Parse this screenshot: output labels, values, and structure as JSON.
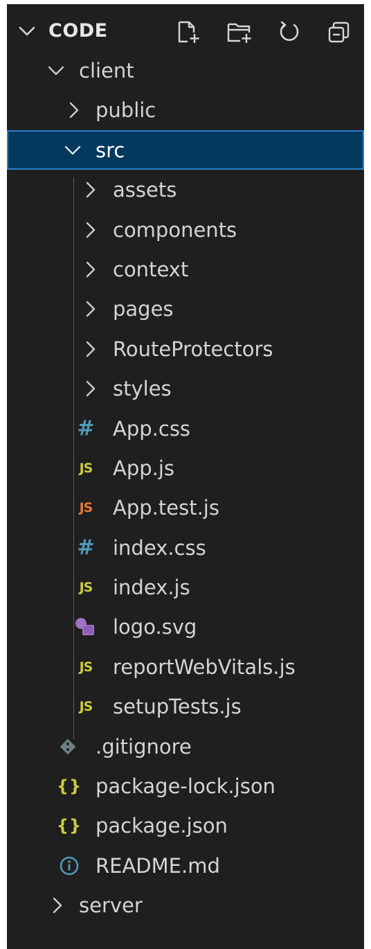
{
  "header": {
    "title": "CODE",
    "actions": [
      {
        "name": "new-file",
        "icon": "new-file-icon"
      },
      {
        "name": "new-folder",
        "icon": "new-folder-icon"
      },
      {
        "name": "refresh",
        "icon": "refresh-icon"
      },
      {
        "name": "collapse-all",
        "icon": "collapse-all-icon"
      }
    ]
  },
  "tree": [
    {
      "label": "client",
      "kind": "folder",
      "expanded": true,
      "depth": 0
    },
    {
      "label": "public",
      "kind": "folder",
      "expanded": false,
      "depth": 1
    },
    {
      "label": "src",
      "kind": "folder",
      "expanded": true,
      "depth": 1,
      "selected": true
    },
    {
      "label": "assets",
      "kind": "folder",
      "expanded": false,
      "depth": 2
    },
    {
      "label": "components",
      "kind": "folder",
      "expanded": false,
      "depth": 2
    },
    {
      "label": "context",
      "kind": "folder",
      "expanded": false,
      "depth": 2
    },
    {
      "label": "pages",
      "kind": "folder",
      "expanded": false,
      "depth": 2
    },
    {
      "label": "RouteProtectors",
      "kind": "folder",
      "expanded": false,
      "depth": 2
    },
    {
      "label": "styles",
      "kind": "folder",
      "expanded": false,
      "depth": 2
    },
    {
      "label": "App.css",
      "kind": "file",
      "icon": "css-icon",
      "icon_text": "#",
      "depth": 2
    },
    {
      "label": "App.js",
      "kind": "file",
      "icon": "js-icon",
      "icon_text": "JS",
      "depth": 2
    },
    {
      "label": "App.test.js",
      "kind": "file",
      "icon": "js-test-icon",
      "icon_text": "JS",
      "depth": 2
    },
    {
      "label": "index.css",
      "kind": "file",
      "icon": "css-icon",
      "icon_text": "#",
      "depth": 2
    },
    {
      "label": "index.js",
      "kind": "file",
      "icon": "js-icon",
      "icon_text": "JS",
      "depth": 2
    },
    {
      "label": "logo.svg",
      "kind": "file",
      "icon": "svg-image-icon",
      "depth": 2
    },
    {
      "label": "reportWebVitals.js",
      "kind": "file",
      "icon": "js-icon",
      "icon_text": "JS",
      "depth": 2
    },
    {
      "label": "setupTests.js",
      "kind": "file",
      "icon": "js-icon",
      "icon_text": "JS",
      "depth": 2
    },
    {
      "label": ".gitignore",
      "kind": "file",
      "icon": "git-icon",
      "depth": 1
    },
    {
      "label": "package-lock.json",
      "kind": "file",
      "icon": "json-icon",
      "icon_text": "{}",
      "depth": 1
    },
    {
      "label": "package.json",
      "kind": "file",
      "icon": "json-icon",
      "icon_text": "{}",
      "depth": 1
    },
    {
      "label": "README.md",
      "kind": "file",
      "icon": "info-icon",
      "depth": 1
    },
    {
      "label": "server",
      "kind": "folder",
      "expanded": false,
      "depth": 0
    }
  ],
  "colors": {
    "background": "#1f1f1f",
    "selection": "#04395e",
    "selection_border": "#2c7fd1",
    "js": "#cbcb41",
    "js_test": "#e37933",
    "css": "#519aba",
    "svg": "#a074c4",
    "info": "#519aba",
    "git": "#6d8086"
  }
}
